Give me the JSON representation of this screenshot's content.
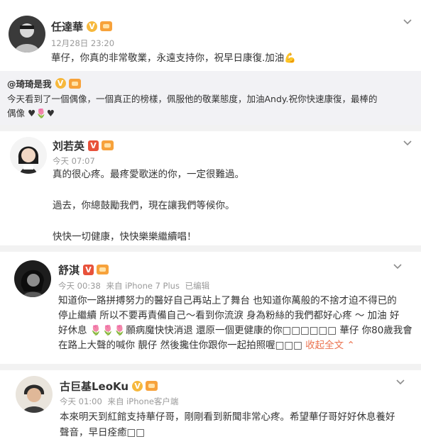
{
  "posts": [
    {
      "user": "任達華",
      "time": "12月28日 23:20",
      "source": "",
      "lines": [
        "華仔，你真的非常敬業，永遠支持你，祝早日康復.加油💪"
      ],
      "repost": {
        "user": "@琦琦是我",
        "lines": [
          "今天看到了一個偶像，一個真正的榜樣，佩服他的敬業態度，加油Andy.祝你快速康復，最棒的",
          "偶像 ♥🌷♥"
        ]
      }
    },
    {
      "user": "刘若英",
      "time": "今天 07:07",
      "source": "",
      "lines": [
        "真的很心疼。最疼愛歌迷的你，一定很難過。",
        "",
        "過去，你總鼓勵我們，現在讓我們等候你。",
        "",
        "快快一切健康，快快樂樂繼續唱！"
      ]
    },
    {
      "user": "舒淇",
      "time": "今天 00:38",
      "source": "来自 iPhone 7 Plus",
      "edited": "已编辑",
      "lines": [
        "知道你一路拼搏努力的醫好自己再站上了舞台 也知道你萬般的不捨才迫不得已的",
        "停止繼續 所以不要再責備自己～看到你流淚 身為粉絲的我們都好心疼 ～ 加油 好",
        "好休息 🌷🌷🌷願病魔快快消退 還原一個更健康的你□□□□□□ 華仔 你80歲我會",
        "在路上大聲的喊你 靚仔 然後攙住你跟你一起拍照喔□□□"
      ],
      "collapse": "收起全文 ⌃"
    },
    {
      "user": "古巨基LeoKu",
      "time": "今天 01:00",
      "source": "来自 iPhone客户端",
      "lines": [
        "本來明天到紅館支持華仔哥，剛剛看到新聞非常心疼。希望華仔哥好好休息養好",
        "聲音，早日痊癒□□"
      ]
    }
  ],
  "icons": {
    "verified": "verified-v-icon",
    "member": "member-crown-icon",
    "more": "chevron-down-icon"
  },
  "colors": {
    "verified_gold": "#f6b83c",
    "verified_red": "#e8523b",
    "member": "#f7a23b",
    "link": "#eb7350"
  }
}
